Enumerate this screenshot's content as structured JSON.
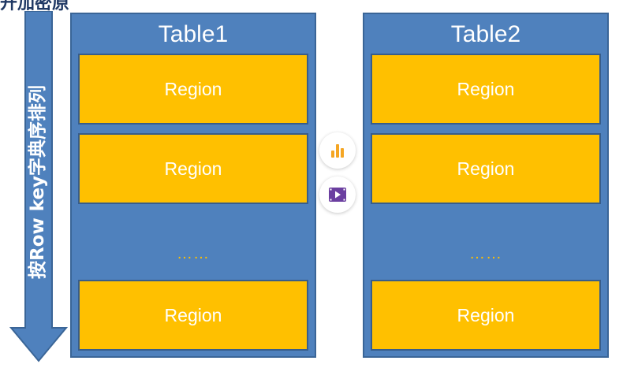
{
  "header": {
    "partial_text": "开加密原"
  },
  "arrow": {
    "label": "按Row key字典序排列",
    "color": "#4f81bd"
  },
  "tables": [
    {
      "title": "Table1",
      "regions": [
        "Region",
        "Region",
        "Region"
      ],
      "ellipsis": "……"
    },
    {
      "title": "Table2",
      "regions": [
        "Region",
        "Region",
        "Region"
      ],
      "ellipsis": "……"
    }
  ],
  "floating_buttons": [
    {
      "icon": "bar-chart-icon",
      "color": "#f5a623"
    },
    {
      "icon": "video-play-icon",
      "color": "#6b3fa0"
    }
  ],
  "colors": {
    "table_bg": "#4f81bd",
    "region_bg": "#ffc000",
    "region_border": "#385d8a"
  }
}
